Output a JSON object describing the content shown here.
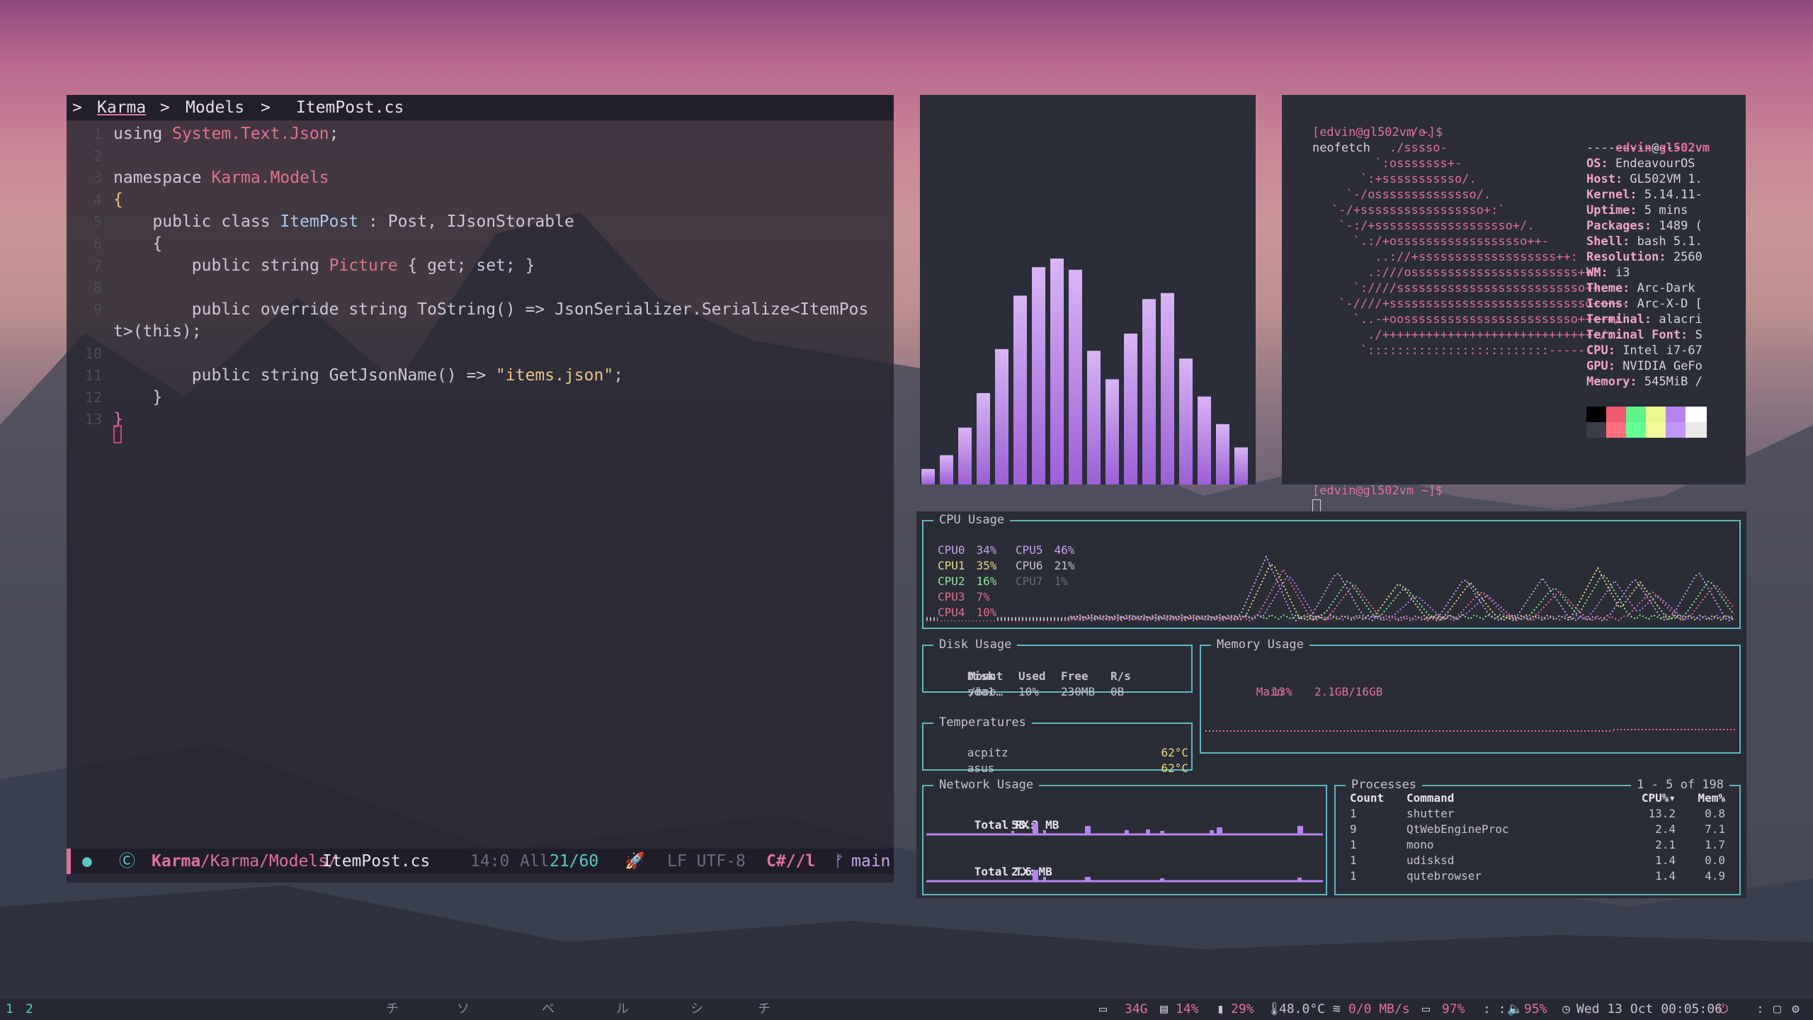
{
  "editor": {
    "breadcrumb": {
      "root": "Karma",
      "folder": "Models",
      "file": "ItemPost.cs",
      "sep": ">"
    },
    "lines": [
      {
        "n": "1",
        "parts": [
          [
            "pl",
            "using "
          ],
          [
            "ty",
            "System.Text.Json"
          ],
          [
            "pl",
            ";"
          ]
        ]
      },
      {
        "n": "2",
        "parts": []
      },
      {
        "n": "3",
        "parts": [
          [
            "pl",
            "namespace "
          ],
          [
            "ty",
            "Karma.Models"
          ]
        ]
      },
      {
        "n": "4",
        "parts": [
          [
            "st",
            "{"
          ]
        ]
      },
      {
        "n": "5",
        "parts": [
          [
            "pl",
            "    public class "
          ],
          [
            "nm",
            "ItemPost"
          ],
          [
            "pl",
            " : Post, IJsonStorable"
          ]
        ]
      },
      {
        "n": "6",
        "parts": [
          [
            "pl",
            "    {"
          ]
        ]
      },
      {
        "n": "7",
        "parts": [
          [
            "pl",
            "        public string "
          ],
          [
            "ty",
            "Picture"
          ],
          [
            "pl",
            " { get; set; }"
          ]
        ]
      },
      {
        "n": "8",
        "parts": []
      },
      {
        "n": "9",
        "parts": [
          [
            "pl",
            "        public override string ToString() => JsonSerializer.Serialize<ItemPos"
          ]
        ]
      },
      {
        "n": "",
        "parts": [
          [
            "pl",
            "t>(this);"
          ]
        ]
      },
      {
        "n": "10",
        "parts": []
      },
      {
        "n": "11",
        "parts": [
          [
            "pl",
            "        public string GetJsonName() => "
          ],
          [
            "st",
            "\"items.json\""
          ],
          [
            "pl",
            ";"
          ]
        ]
      },
      {
        "n": "12",
        "parts": [
          [
            "pl",
            "    }"
          ]
        ]
      },
      {
        "n": "13",
        "parts": [
          [
            "kw",
            "}"
          ]
        ]
      }
    ],
    "status": {
      "path_root": "Karma",
      "path_rest": "/Karma/Models/",
      "file": "ItemPost.cs",
      "pos": "14:0",
      "all": "All",
      "lines": "21/60",
      "encoding": "LF UTF-8",
      "lang": "C#//l",
      "branch": "main"
    }
  },
  "bars": {
    "values": [
      18,
      34,
      66,
      106,
      157,
      219,
      252,
      262,
      249,
      155,
      122,
      175,
      215,
      222,
      146,
      102,
      70,
      43
    ]
  },
  "neofetch": {
    "prompt": "[edvin@gl502vm ~]$",
    "command": "neofetch",
    "user": "edvin",
    "host": "gl502vm",
    "rule": "-------------",
    "logo": [
      "          ./o.",
      "        ./sssso-",
      "      `:osssssss+-",
      "    `:+sssssssssso/.",
      "  `-/ossssssssssssso/.",
      "`-/+sssssssssssssssso+:`",
      " `-:/+sssssssssssssssssso+/.",
      "   `.:/+ossssssssssssssssso++-",
      "      ..://+sssssssssssssssssss++:",
      "     .:///osssssssssssssssssssssss++:",
      "   `:////ssssssssssssssssssssssssso++.",
      " `-////+ssssssssssssssssssssssssssso++++-",
      "   `..-+oossssssssssssssssssssssso+++++/`",
      "     ./++++++++++++++++++++++++++++++/:.",
      "    `:::::::::::::::::::::::::------``"
    ],
    "info": [
      [
        "OS",
        "EndeavourOS"
      ],
      [
        "Host",
        "GL502VM 1."
      ],
      [
        "Kernel",
        "5.14.11-"
      ],
      [
        "Uptime",
        "5 mins"
      ],
      [
        "Packages",
        "1489 ("
      ],
      [
        "Shell",
        "bash 5.1."
      ],
      [
        "Resolution",
        "2560"
      ],
      [
        "WM",
        "i3"
      ],
      [
        "Theme",
        "Arc-Dark"
      ],
      [
        "Icons",
        "Arc-X-D ["
      ],
      [
        "Terminal",
        "alacri"
      ],
      [
        "Terminal Font",
        "S"
      ],
      [
        "CPU",
        "Intel i7-67"
      ],
      [
        "GPU",
        "NVIDIA GeFo"
      ],
      [
        "Memory",
        "545MiB /"
      ]
    ],
    "colors": [
      "#000000",
      "#ef5a6f",
      "#62f28a",
      "#ecf78f",
      "#b682f0",
      "#ffffff"
    ],
    "colors2": [
      "#3b3d48",
      "#ff6f80",
      "#66ff94",
      "#f4fb98",
      "#c295ff",
      "#e9e9e9"
    ]
  },
  "btop": {
    "cpu_title": "CPU Usage",
    "cpus": [
      {
        "name": "CPU0",
        "pct": "34%",
        "color": "#c7a3ee"
      },
      {
        "name": "CPU1",
        "pct": "35%",
        "color": "#e8d98a"
      },
      {
        "name": "CPU2",
        "pct": "16%",
        "color": "#8fe39a"
      },
      {
        "name": "CPU3",
        "pct": "7%",
        "color": "#e06f95"
      },
      {
        "name": "CPU4",
        "pct": "10%",
        "color": "#e06f95"
      },
      {
        "name": "CPU5",
        "pct": "46%",
        "color": "#c7a3ee"
      },
      {
        "name": "CPU6",
        "pct": "21%",
        "color": "#c5c3d0"
      },
      {
        "name": "CPU7",
        "pct": "1%",
        "color": "#6b6a78"
      }
    ],
    "disk_title": "Disk Usage",
    "disk_head": [
      "Disk",
      "Mount",
      "Used",
      "Free",
      "R/s"
    ],
    "disk_row": [
      "sda1",
      "/boo…",
      "10%",
      "230MB",
      "0B"
    ],
    "mem_title": "Memory Usage",
    "mem_label": "Main",
    "mem_pct": "13%",
    "mem_value": "2.1GB/16GB",
    "temp_title": "Temperatures",
    "temps": [
      {
        "name": "acpitz",
        "value": "62°C"
      },
      {
        "name": "asus",
        "value": "62°C"
      }
    ],
    "net_title": "Network Usage",
    "rx_label": "Total RX:",
    "rx_value": "53.3 MB",
    "tx_label": "Total TX:",
    "tx_value": "2.6 MB",
    "proc_title": "Processes",
    "proc_range": "1 - 5 of 198",
    "proc_head": [
      "Count",
      "Command",
      "CPU%▾",
      "Mem%"
    ],
    "procs": [
      [
        "1",
        "shutter",
        "13.2",
        "0.8"
      ],
      [
        "9",
        "QtWebEngineProc",
        "2.4",
        "7.1"
      ],
      [
        "1",
        "mono",
        "2.1",
        "1.7"
      ],
      [
        "1",
        "udisksd",
        "1.4",
        "0.0"
      ],
      [
        "1",
        "qutebrowser",
        "1.4",
        "4.9"
      ]
    ]
  },
  "taskbar": {
    "workspaces": [
      "1",
      "2"
    ],
    "kana": [
      "チ",
      "ソ",
      "ベ",
      "ル",
      "シ",
      "チ"
    ],
    "storage": "34G",
    "mem": "14%",
    "cpu": "29%",
    "temp": "48.0°C",
    "net": "0/0 MB/s",
    "battery": "97%",
    "volume": "95%",
    "datetime": "Wed 13 Oct 00:05:06"
  }
}
